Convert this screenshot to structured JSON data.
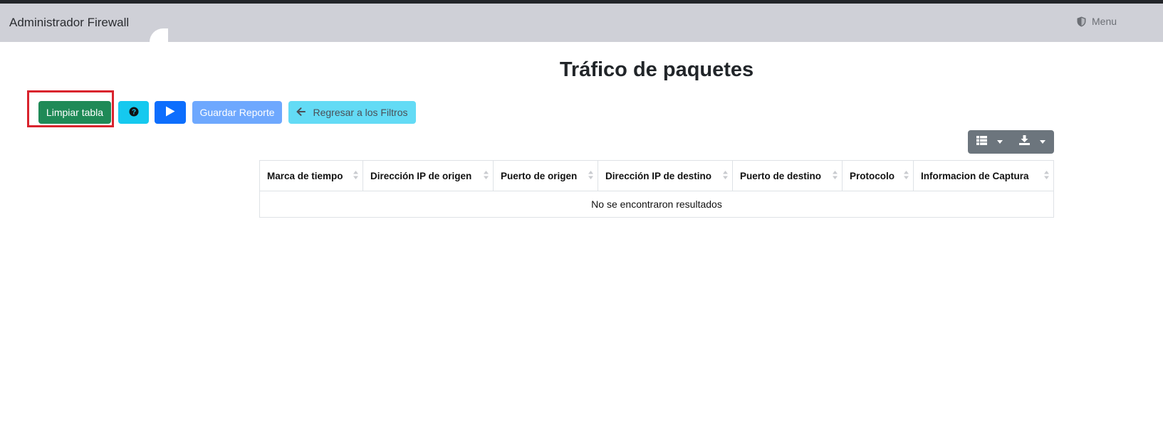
{
  "app": {
    "brand": "Administrador Firewall",
    "menu_label": "Menu",
    "menu_icon": "shield-icon"
  },
  "page": {
    "title": "Tráfico de paquetes"
  },
  "toolbar": {
    "clear_label": "Limpiar tabla",
    "help_icon": "question-circle-icon",
    "play_icon": "play-icon",
    "save_label": "Guardar Reporte",
    "back_label": "Regresar a los Filtros",
    "back_icon": "arrow-left-icon"
  },
  "table_tools": {
    "columns_icon": "columns-icon",
    "export_icon": "download-icon"
  },
  "table": {
    "headers": [
      "Marca de tiempo",
      "Dirección IP de origen",
      "Puerto de origen",
      "Dirección IP de destino",
      "Puerto de destino",
      "Protocolo",
      "Informacion de Captura"
    ],
    "empty_message": "No se encontraron resultados"
  },
  "colors": {
    "navbar": "#cfd0d7",
    "success": "#1f8a57",
    "info": "#15c9ef",
    "primary": "#0d6efd",
    "highlight": "#d9232d"
  }
}
